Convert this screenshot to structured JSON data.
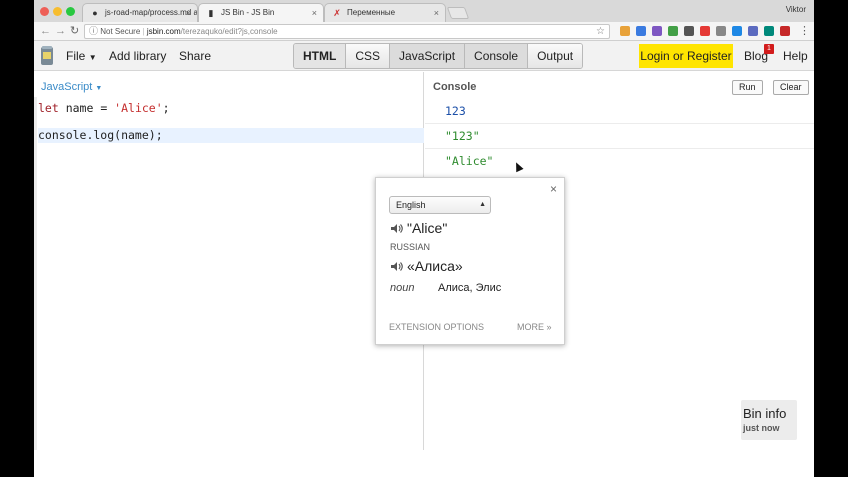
{
  "browser": {
    "tabs": [
      {
        "title": "js-road-map/process.md at m",
        "active": false
      },
      {
        "title": "JS Bin - JS Bin",
        "active": true
      },
      {
        "title": "Переменные",
        "active": false
      }
    ],
    "profile": "Viktor",
    "address": {
      "security": "Not Secure",
      "host": "jsbin.com",
      "path": "/terezaquko/edit?js,console"
    }
  },
  "toolbar": {
    "file": "File",
    "add_library": "Add library",
    "share": "Share",
    "panels": [
      "HTML",
      "CSS",
      "JavaScript",
      "Console",
      "Output"
    ],
    "login": "Login or Register",
    "blog": "Blog",
    "blog_badge": "1",
    "help": "Help"
  },
  "editor": {
    "language": "JavaScript",
    "code": {
      "line1_kw": "let",
      "line1_rest": " name = ",
      "line1_str": "'Alice'",
      "line1_end": ";",
      "line2": "console.log(name);"
    }
  },
  "console": {
    "title": "Console",
    "run": "Run",
    "clear": "Clear",
    "outputs": [
      "123",
      "\"123\"",
      "\"Alice\""
    ]
  },
  "bin_info": {
    "title": "Bin info",
    "subtitle": "just now"
  },
  "translate_popup": {
    "source_language": "English",
    "source_word": "\"Alice\"",
    "target_language_label": "RUSSIAN",
    "translation": "«Алиса»",
    "part_of_speech": "noun",
    "definitions": "Алиса, Элис",
    "extension_options": "EXTENSION OPTIONS",
    "more": "MORE »"
  },
  "colors": {
    "login_bg": "#ffe500",
    "badge": "#d21c1c",
    "number_output": "#1b4fa8",
    "string_output": "#2e8b2e",
    "keyword": "#a0222a",
    "language_link": "#3a8bc8"
  }
}
